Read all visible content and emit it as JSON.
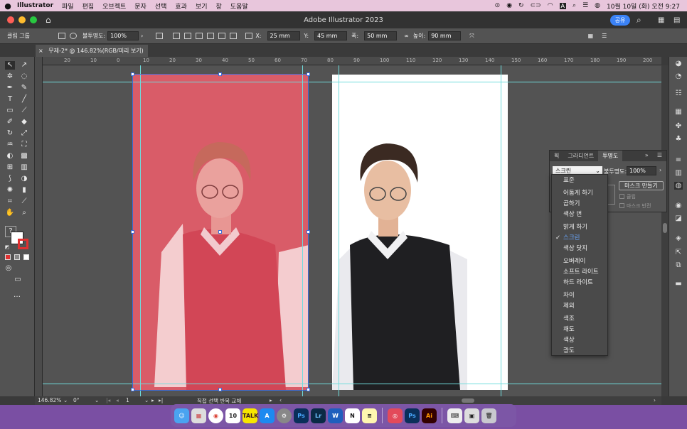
{
  "menubar": {
    "app_name": "Illustrator",
    "items": [
      "파일",
      "편집",
      "오브젝트",
      "문자",
      "선택",
      "효과",
      "보기",
      "창",
      "도움말"
    ],
    "clock": "10월 10일 (화) 오전 9:27"
  },
  "titlebar": {
    "title": "Adobe Illustrator 2023",
    "share": "공유"
  },
  "controlbar": {
    "selection_label": "클립 그룹",
    "opacity_label": "불투명도:",
    "opacity_value": "100%",
    "x_label": "X:",
    "x_value": "25 mm",
    "y_label": "Y:",
    "y_value": "45 mm",
    "w_label": "폭:",
    "w_value": "50 mm",
    "h_label": "높이:",
    "h_value": "90 mm"
  },
  "document": {
    "tab_label": "무제-2* @ 146.82%(RGB/미리 보기)"
  },
  "ruler": {
    "ticks": [
      "20",
      "10",
      "0",
      "10",
      "20",
      "30",
      "40",
      "50",
      "60",
      "70",
      "80",
      "90",
      "100",
      "110",
      "120",
      "130",
      "140",
      "150",
      "160",
      "170",
      "180",
      "190",
      "200"
    ]
  },
  "canvas": {
    "left_artboard_color": "#d95c68",
    "guide_color": "#6fdcdc"
  },
  "panel": {
    "tabs": [
      "획",
      "그라디언트",
      "투명도"
    ],
    "active_tab": "투명도",
    "blend_mode": "스크린",
    "opacity_label": "불투명도:",
    "opacity_value": "100%",
    "mask_button": "마스크 만들기",
    "clip_label": "클립",
    "invert_label": "마스크 반전"
  },
  "blend_menu": {
    "items": [
      "표준",
      "어둡게 하기",
      "곱하기",
      "색상 번",
      "밝게 하기",
      "스크린",
      "색상 닷지",
      "오버레이",
      "소프트 라이트",
      "하드 라이트",
      "차이",
      "제외",
      "색조",
      "채도",
      "색상",
      "광도"
    ],
    "selected": "스크린"
  },
  "statusbar": {
    "zoom": "146.82%",
    "rotation": "0°",
    "artboard": "1",
    "tool_hint": "직접 선택 반복 교체"
  },
  "dock": {
    "apps": [
      "finder",
      "launchpad",
      "chrome",
      "calendar",
      "kakaotalk",
      "app-store",
      "system-settings",
      "photoshop",
      "lightroom",
      "word",
      "notion",
      "notes",
      "creative-cloud",
      "photoshop-2",
      "illustrator",
      "keyboard",
      "preview",
      "trash"
    ],
    "calendar_day": "10"
  }
}
